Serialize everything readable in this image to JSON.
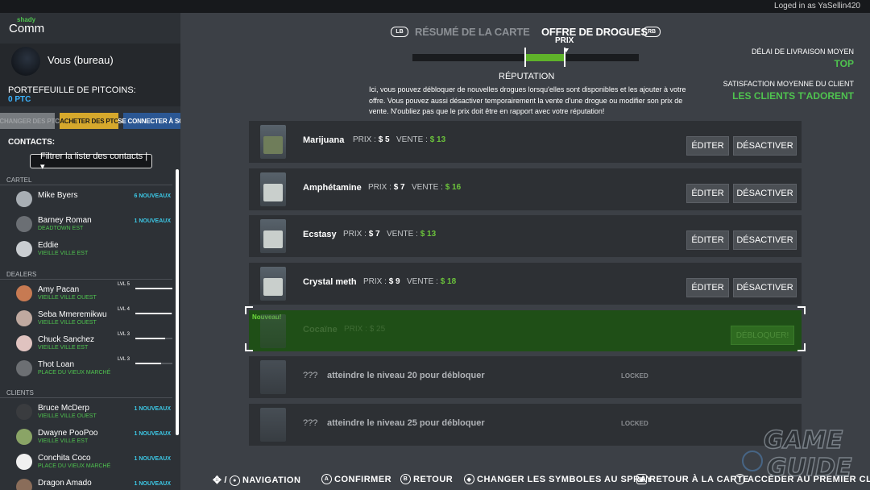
{
  "topbar": {
    "login_text": "Loged in as YaSellin420"
  },
  "brand": {
    "shady": "shady",
    "comm": "Comm"
  },
  "profile": {
    "name": "Vous (bureau)"
  },
  "wallet": {
    "label": "PORTEFEUILLE DE PITCOINS:",
    "value": "0 PTC"
  },
  "buttons": {
    "disabled": "ÉCHANGER DES PTC",
    "buy": "ACHETER DES PTC",
    "connect": "SE CONNECTER À SON COMPTE >>"
  },
  "contacts": {
    "label": "CONTACTS:",
    "filter": "Filtrer la liste des contacts |▾"
  },
  "sections": {
    "cartel": "CARTEL",
    "dealers": "DEALERS",
    "clients": "CLIENTS"
  },
  "cartel": [
    {
      "name": "Mike Byers",
      "location": "",
      "badge": "6 NOUVEAUX"
    },
    {
      "name": "Barney Roman",
      "location": "DEADTOWN EST",
      "badge": "1 NOUVEAUX"
    },
    {
      "name": "Eddie",
      "location": "VIEILLE VILLE EST",
      "badge": ""
    }
  ],
  "dealers": [
    {
      "name": "Amy Pacan",
      "location": "VIEILLE VILLE OUEST",
      "level": "LVL 5",
      "progress": 1.0
    },
    {
      "name": "Seba Mmeremikwu",
      "location": "VIEILLE VILLE OUEST",
      "level": "LVL 4",
      "progress": 0.98
    },
    {
      "name": "Chuck Sanchez",
      "location": "VIEILLE VILLE EST",
      "level": "LVL 3",
      "progress": 0.8
    },
    {
      "name": "Thot Loan",
      "location": "PLACE DU VIEUX MARCHÉ",
      "level": "LVL 3",
      "progress": 0.7
    }
  ],
  "clients": [
    {
      "name": "Bruce McDerp",
      "location": "VIEILLE VILLE OUEST",
      "badge": "1 NOUVEAUX"
    },
    {
      "name": "Dwayne PooPoo",
      "location": "VIEILLE VILLE EST",
      "badge": "1 NOUVEAUX"
    },
    {
      "name": "Conchita Coco",
      "location": "PLACE DU VIEUX MARCHÉ",
      "badge": "1 NOUVEAUX"
    },
    {
      "name": "Dragon Amado",
      "location": "",
      "badge": "1 NOUVEAUX"
    }
  ],
  "header": {
    "lb": "LB",
    "rb": "RB",
    "tab_resume": "RÉSUMÉ DE LA CARTE",
    "tab_offre": "OFFRE DE DROGUES",
    "prix": "PRIX",
    "reputation": "RÉPUTATION",
    "reputation_fill": 0.18,
    "intro": "Ici, vous pouvez débloquer de nouvelles drogues lorsqu'elles sont disponibles et les ajouter à votre offre. Vous pouvez aussi désactiver temporairement la vente d'une drogue ou modifier son prix de vente. N'oubliez pas que le prix doit être en rapport avec votre réputation!"
  },
  "stats": {
    "delay_label": "DÉLAI DE LIVRAISON MOYEN",
    "delay_value": "TOP",
    "satisfaction_label": "SATISFACTION MOYENNE DU CLIENT",
    "satisfaction_value": "LES CLIENTS T'ADORENT"
  },
  "labels": {
    "prix": "PRIX :",
    "vente": "VENTE :",
    "edit": "ÉDITER",
    "disable": "DÉSACTIVER",
    "unlock": "DÉBLOQUER!",
    "locked": "LOCKED",
    "nouveau": "Nouveau!",
    "qqq": "???"
  },
  "drugs": [
    {
      "name": "Marijuana",
      "prix": "$ 5",
      "vente": "$ 13"
    },
    {
      "name": "Amphétamine",
      "prix": "$ 7",
      "vente": "$ 16"
    },
    {
      "name": "Ecstasy",
      "prix": "$ 7",
      "vente": "$ 13"
    },
    {
      "name": "Crystal meth",
      "prix": "$ 9",
      "vente": "$ 18"
    }
  ],
  "new_drug": {
    "name": "Cocaïne",
    "prix": "$ 25"
  },
  "locked": [
    {
      "text": "atteindre le niveau 20 pour débloquer"
    },
    {
      "text": "atteindre le niveau 25 pour débloquer"
    }
  ],
  "footer": {
    "navigation": "NAVIGATION",
    "confirmer": "CONFIRMER",
    "retour": "RETOUR",
    "symboles": "CHANGER LES SYMBOLES AU SPRAY",
    "carte": "RETOUR À LA CARTE",
    "client": "ACCÉDER AU PREMIER CLIENT",
    "btn_a": "A",
    "btn_b": "B",
    "btn_y": "Y",
    "slash": "/"
  },
  "watermark": {
    "line1": "GAME",
    "line2": "GUIDE"
  },
  "colors": {
    "accent_green": "#4fc34f",
    "badge_cyan": "#3cc8e6",
    "wallet_blue": "#3cb4ff",
    "buy_yellow": "#d6a82c"
  }
}
